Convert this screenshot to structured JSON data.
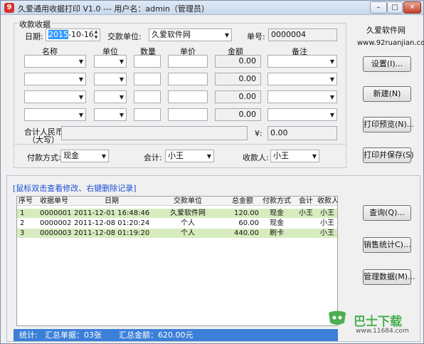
{
  "window": {
    "title": "久爱通用收据打印 V1.0 --- 用户名：admin（管理员）",
    "icon_glyph": "9",
    "minimize": "–",
    "maximize": "□",
    "close": "✕"
  },
  "receipt": {
    "group_title": "收款收据",
    "date_label": "日期:",
    "date_year": "2015",
    "date_rest": "-10-16",
    "payer_label": "交款单位:",
    "payer_value": "久爱软件网",
    "number_label": "单号:",
    "number_value": "0000004",
    "columns": {
      "name": "名称",
      "unit": "单位",
      "qty": "数量",
      "price": "单价",
      "amount": "金额",
      "note": "备注"
    },
    "rows": [
      {
        "amount": "0.00"
      },
      {
        "amount": "0.00"
      },
      {
        "amount": "0.00"
      },
      {
        "amount": "0.00"
      }
    ],
    "total_cn_label_1": "合计人民币",
    "total_cn_label_2": "（大写）",
    "yen_label": "¥:",
    "total_value": "0.00",
    "pay_method_label": "付款方式:",
    "pay_method_value": "现金",
    "accountant_label": "会计:",
    "accountant_value": "小王",
    "receiver_label": "收款人:",
    "receiver_value": "小王"
  },
  "side": {
    "brand": "久爱软件网",
    "website": "www.92ruanjian.com",
    "settings_button": "设置(I)...",
    "new_button": "新建(N)",
    "print_preview_button": "打印预览(N)...",
    "print_save_button": "打印并保存(S)",
    "query_button": "查询(Q)...",
    "sales_stats_button": "销售统计C)...",
    "manage_data_button": "管理数据(M)..."
  },
  "records": {
    "hint": "[鼠标双击查看修改、右键删除记录]",
    "headers": [
      "序号",
      "收据单号",
      "日期",
      "交款单位",
      "总金额",
      "付款方式",
      "会计",
      "收款人"
    ],
    "rows": [
      [
        "1",
        "0000001",
        "2011-12-01 16:48:46",
        "久爱软件网",
        "120.00",
        "现金",
        "小王",
        "小王"
      ],
      [
        "2",
        "0000002",
        "2011-12-08 01:20:24",
        "个人",
        "60.00",
        "现金",
        "",
        "小王"
      ],
      [
        "3",
        "0000003",
        "2011-12-08 01:19:20",
        "个人",
        "440.00",
        "刷卡",
        "",
        "小王"
      ]
    ]
  },
  "status": {
    "label": "统计:",
    "count": "汇总单据：03张",
    "amount": "汇总金额：620.00元"
  },
  "watermark": {
    "text": "巴士下载",
    "url": "www.11684.com"
  }
}
